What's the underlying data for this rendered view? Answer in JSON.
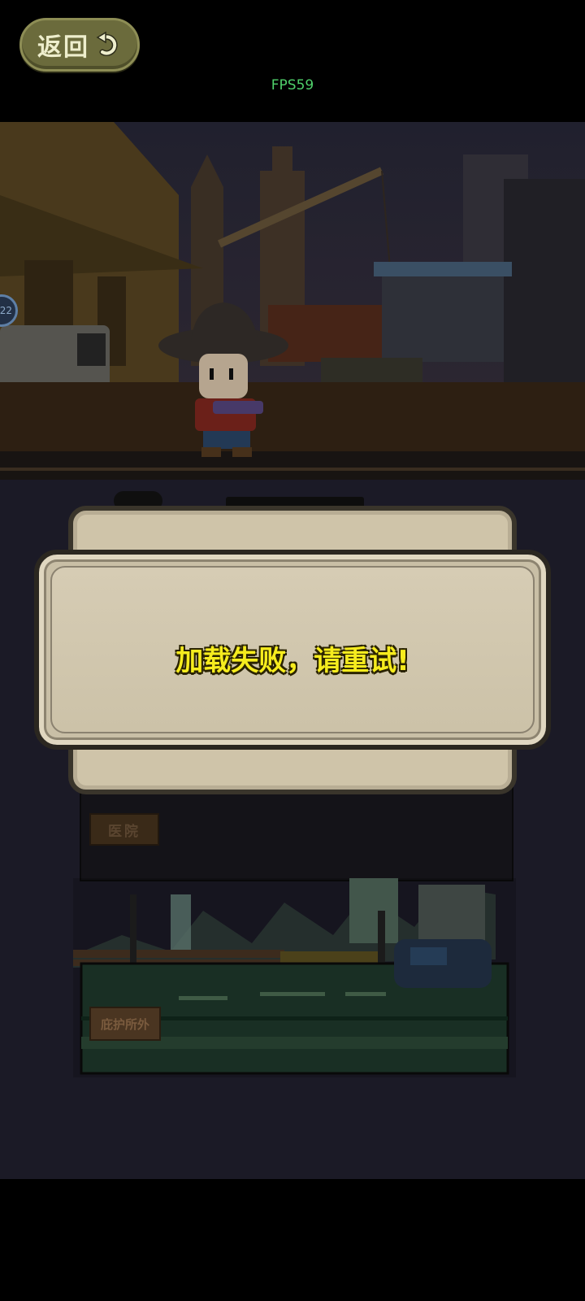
{
  "header": {
    "back_label": "返回",
    "fps_text": "FPS59"
  },
  "scene": {
    "level_badge": "22"
  },
  "base": {
    "hospital_label": "医院",
    "outside_label": "庇护所外"
  },
  "dialog": {
    "message": "加载失败，请重试!"
  },
  "colors": {
    "message_text": "#f6ec1e",
    "dialog_bg": "#c9bfa6",
    "back_button": "#6b6b3c"
  }
}
